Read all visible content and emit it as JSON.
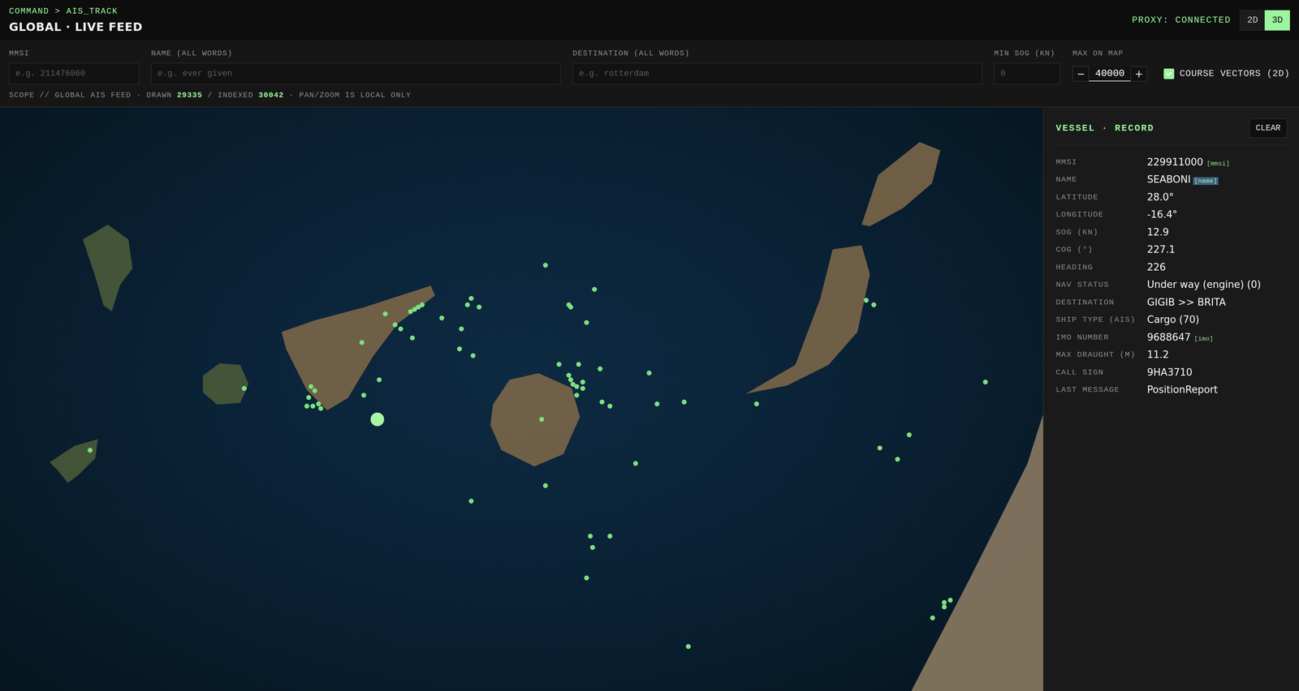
{
  "header": {
    "breadcrumb": "COMMAND > AIS_TRACK",
    "title": "GLOBAL · LIVE FEED",
    "proxy": "PROXY: CONNECTED",
    "view_modes": [
      {
        "label": "2D",
        "selected": false
      },
      {
        "label": "3D",
        "selected": true
      }
    ]
  },
  "filters": {
    "fields": [
      {
        "label": "MMSI",
        "placeholder": "e.g. 211476060"
      },
      {
        "label": "NAME (ALL WORDS)",
        "placeholder": "e.g. ever given"
      },
      {
        "label": "DESTINATION (ALL WORDS)",
        "placeholder": "e.g. rotterdam"
      },
      {
        "label": "MIN SOG (KN)",
        "placeholder": "0"
      }
    ],
    "max_on_map": {
      "label": "MAX ON MAP",
      "value": "40000",
      "minus": "−",
      "plus": "+"
    },
    "course_vectors": {
      "label": "COURSE VECTORS (2D)",
      "checked": true
    }
  },
  "scope": {
    "prefix": "SCOPE // GLOBAL AIS FEED · DRAWN",
    "drawn": "29335",
    "mid": "/ INDEXED",
    "indexed": "30042",
    "suffix": "· PAN/ZOOM IS LOCAL ONLY"
  },
  "map": {
    "vessels": [
      {
        "lat": 28.0,
        "lon": -16.4,
        "selected": true
      },
      {
        "lat": 28.7,
        "lon": -15.54,
        "selected": false
      },
      {
        "lat": 28.59,
        "lon": -15.29,
        "selected": false
      },
      {
        "lat": 28.55,
        "lon": -15.92,
        "selected": false
      },
      {
        "lat": 28.52,
        "lon": -15.94,
        "selected": false
      },
      {
        "lat": 28.51,
        "lon": -15.88,
        "selected": false
      },
      {
        "lat": 28.52,
        "lon": -15.42,
        "selected": false
      },
      {
        "lat": 28.51,
        "lon": -15.41,
        "selected": false
      },
      {
        "lat": 28.44,
        "lon": -15.33,
        "selected": false
      },
      {
        "lat": 28.46,
        "lon": -16.07,
        "selected": false
      },
      {
        "lat": 28.48,
        "lon": -16.36,
        "selected": false
      },
      {
        "lat": 28.43,
        "lon": -16.31,
        "selected": false
      },
      {
        "lat": 28.49,
        "lon": -16.23,
        "selected": false
      },
      {
        "lat": 28.5,
        "lon": -16.21,
        "selected": false
      },
      {
        "lat": 28.51,
        "lon": -16.19,
        "selected": false
      },
      {
        "lat": 28.52,
        "lon": -16.17,
        "selected": false
      },
      {
        "lat": 28.41,
        "lon": -16.28,
        "selected": false
      },
      {
        "lat": 28.37,
        "lon": -16.22,
        "selected": false
      },
      {
        "lat": 28.41,
        "lon": -15.97,
        "selected": false
      },
      {
        "lat": 28.35,
        "lon": -16.48,
        "selected": false
      },
      {
        "lat": 28.32,
        "lon": -15.98,
        "selected": false
      },
      {
        "lat": 28.29,
        "lon": -15.91,
        "selected": false
      },
      {
        "lat": 28.18,
        "lon": -16.39,
        "selected": false
      },
      {
        "lat": 28.11,
        "lon": -16.47,
        "selected": false
      },
      {
        "lat": 28.15,
        "lon": -16.74,
        "selected": false
      },
      {
        "lat": 28.13,
        "lon": -16.72,
        "selected": false
      },
      {
        "lat": 28.1,
        "lon": -16.75,
        "selected": false
      },
      {
        "lat": 28.07,
        "lon": -16.7,
        "selected": false
      },
      {
        "lat": 28.06,
        "lon": -16.73,
        "selected": false
      },
      {
        "lat": 28.06,
        "lon": -16.76,
        "selected": false
      },
      {
        "lat": 28.05,
        "lon": -16.69,
        "selected": false
      },
      {
        "lat": 28.14,
        "lon": -17.08,
        "selected": false
      },
      {
        "lat": 28.25,
        "lon": -15.47,
        "selected": false
      },
      {
        "lat": 28.25,
        "lon": -15.37,
        "selected": false
      },
      {
        "lat": 28.23,
        "lon": -15.26,
        "selected": false
      },
      {
        "lat": 28.2,
        "lon": -15.42,
        "selected": false
      },
      {
        "lat": 28.18,
        "lon": -15.41,
        "selected": false
      },
      {
        "lat": 28.16,
        "lon": -15.4,
        "selected": false
      },
      {
        "lat": 28.15,
        "lon": -15.38,
        "selected": false
      },
      {
        "lat": 28.17,
        "lon": -15.35,
        "selected": false
      },
      {
        "lat": 28.14,
        "lon": -15.35,
        "selected": false
      },
      {
        "lat": 28.11,
        "lon": -15.38,
        "selected": false
      },
      {
        "lat": 28.08,
        "lon": -15.25,
        "selected": false
      },
      {
        "lat": 28.06,
        "lon": -15.21,
        "selected": false
      },
      {
        "lat": 28.21,
        "lon": -15.01,
        "selected": false
      },
      {
        "lat": 28.07,
        "lon": -14.97,
        "selected": false
      },
      {
        "lat": 28.08,
        "lon": -14.83,
        "selected": false
      },
      {
        "lat": 28.07,
        "lon": -14.46,
        "selected": false
      },
      {
        "lat": 28.54,
        "lon": -13.9,
        "selected": false
      },
      {
        "lat": 28.52,
        "lon": -13.86,
        "selected": false
      },
      {
        "lat": 28.17,
        "lon": -13.29,
        "selected": false
      },
      {
        "lat": 27.93,
        "lon": -13.68,
        "selected": false
      },
      {
        "lat": 27.87,
        "lon": -13.83,
        "selected": false
      },
      {
        "lat": 27.82,
        "lon": -13.74,
        "selected": false
      },
      {
        "lat": 27.8,
        "lon": -15.08,
        "selected": false
      },
      {
        "lat": 28.0,
        "lon": -15.56,
        "selected": false
      },
      {
        "lat": 27.7,
        "lon": -15.54,
        "selected": false
      },
      {
        "lat": 27.63,
        "lon": -15.92,
        "selected": false
      },
      {
        "lat": 27.47,
        "lon": -15.31,
        "selected": false
      },
      {
        "lat": 27.47,
        "lon": -15.21,
        "selected": false
      },
      {
        "lat": 27.42,
        "lon": -15.3,
        "selected": false
      },
      {
        "lat": 27.28,
        "lon": -15.33,
        "selected": false
      },
      {
        "lat": 26.97,
        "lon": -14.81,
        "selected": false
      },
      {
        "lat": 27.18,
        "lon": -13.47,
        "selected": false
      },
      {
        "lat": 27.17,
        "lon": -13.5,
        "selected": false
      },
      {
        "lat": 27.15,
        "lon": -13.5,
        "selected": false
      },
      {
        "lat": 27.1,
        "lon": -13.56,
        "selected": false
      },
      {
        "lat": 27.86,
        "lon": -17.87,
        "selected": false
      }
    ]
  },
  "record": {
    "title": "VESSEL · RECORD",
    "clear": "CLEAR",
    "rows": [
      {
        "label": "MMSI",
        "value": "229911000",
        "tag": "[mmsi]",
        "tag_highlighted": false
      },
      {
        "label": "NAME",
        "value": "SEABONI",
        "tag": "[name]",
        "tag_highlighted": true
      },
      {
        "label": "LATITUDE",
        "value": "28.0°",
        "tag": "",
        "tag_highlighted": false
      },
      {
        "label": "LONGITUDE",
        "value": "-16.4°",
        "tag": "",
        "tag_highlighted": false
      },
      {
        "label": "SOG (KN)",
        "value": "12.9",
        "tag": "",
        "tag_highlighted": false
      },
      {
        "label": "COG (°)",
        "value": "227.1",
        "tag": "",
        "tag_highlighted": false
      },
      {
        "label": "HEADING",
        "value": "226",
        "tag": "",
        "tag_highlighted": false
      },
      {
        "label": "NAV STATUS",
        "value": "Under way (engine) (0)",
        "tag": "",
        "tag_highlighted": false
      },
      {
        "label": "DESTINATION",
        "value": "GIGIB >> BRITA",
        "tag": "",
        "tag_highlighted": false
      },
      {
        "label": "SHIP TYPE (AIS)",
        "value": "Cargo (70)",
        "tag": "",
        "tag_highlighted": false
      },
      {
        "label": "IMO NUMBER",
        "value": "9688647",
        "tag": "[imo]",
        "tag_highlighted": false
      },
      {
        "label": "MAX DRAUGHT (M)",
        "value": "11.2",
        "tag": "",
        "tag_highlighted": false
      },
      {
        "label": "CALL SIGN",
        "value": "9HA3710",
        "tag": "",
        "tag_highlighted": false
      },
      {
        "label": "LAST MESSAGE",
        "value": "PositionReport",
        "tag": "",
        "tag_highlighted": false
      }
    ]
  }
}
